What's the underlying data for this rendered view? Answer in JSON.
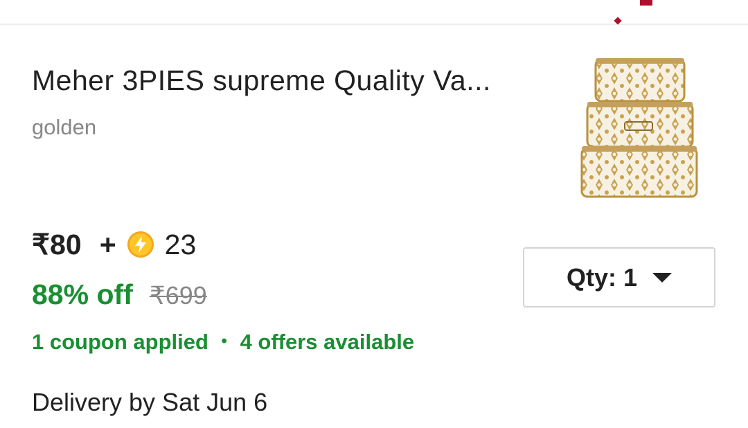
{
  "product": {
    "title": "Meher 3PIES supreme Quality Va...",
    "variant": "golden",
    "image_icon": "vanity-box-set-image"
  },
  "pricing": {
    "price": "₹80",
    "plus": "+",
    "supercoins": "23",
    "discount": "88% off",
    "mrp": "₹699"
  },
  "offers": {
    "coupon": "1 coupon applied",
    "separator": "•",
    "available": "4 offers available"
  },
  "delivery": "Delivery by Sat Jun 6",
  "quantity": {
    "label": "Qty: 1",
    "selected": "1"
  },
  "colors": {
    "accent_green": "#1a8f32",
    "coin_yellow": "#ffc627",
    "brand_red": "#b0102c",
    "muted_gray": "#878787"
  }
}
